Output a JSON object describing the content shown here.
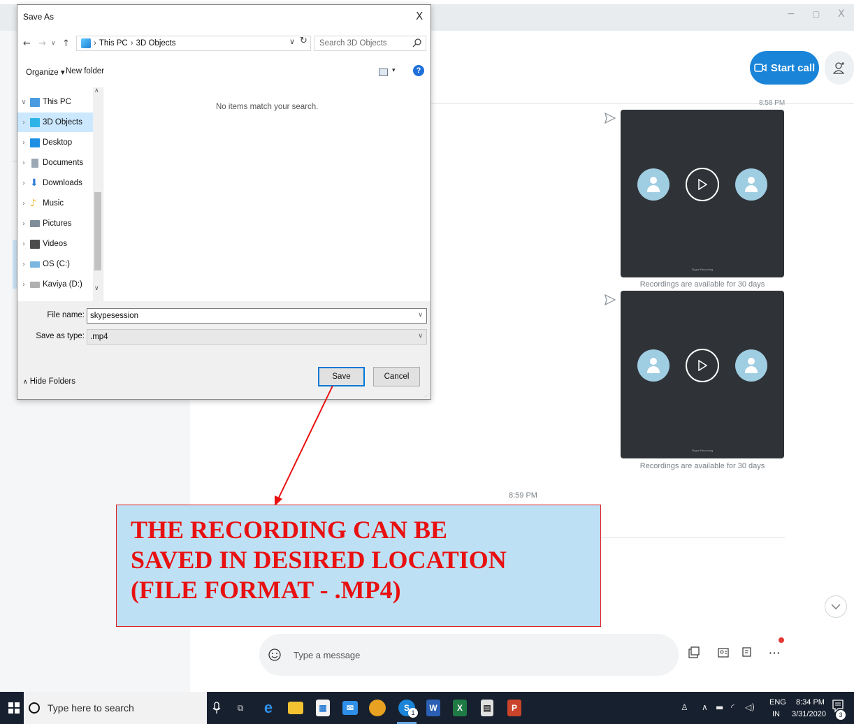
{
  "skype": {
    "start_call_label": "Start call",
    "cut_time": "8:58 PM",
    "recordings": [
      {
        "caption": "Recordings are available for 30 days",
        "watermark": "Skype Recording"
      },
      {
        "caption": "Recordings are available for 30 days",
        "watermark": "Skype Recording"
      }
    ],
    "message_time": "8:59 PM",
    "composer_placeholder": "Type a message",
    "window_controls": {
      "minimize": "−",
      "restore": "▢",
      "close": "X"
    }
  },
  "dialog": {
    "title": "Save As",
    "close": "X",
    "breadcrumb": [
      "This PC",
      "3D Objects"
    ],
    "search_placeholder": "Search 3D Objects",
    "toolbar": {
      "organize": "Organize ▾",
      "new_folder": "New folder"
    },
    "nav_items": [
      {
        "label": "This PC",
        "icon": "computer-icon",
        "color": "#4a9be0"
      },
      {
        "label": "3D Objects",
        "icon": "3d-objects-icon",
        "color": "#2fb4e8"
      },
      {
        "label": "Desktop",
        "icon": "desktop-icon",
        "color": "#1f8fe3"
      },
      {
        "label": "Documents",
        "icon": "documents-icon",
        "color": "#9aa8b5"
      },
      {
        "label": "Downloads",
        "icon": "downloads-icon",
        "color": "#2f7fd6"
      },
      {
        "label": "Music",
        "icon": "music-icon",
        "color": "#f2b526"
      },
      {
        "label": "Pictures",
        "icon": "pictures-icon",
        "color": "#7f8c99"
      },
      {
        "label": "Videos",
        "icon": "videos-icon",
        "color": "#4b4b4b"
      },
      {
        "label": "OS (C:)",
        "icon": "drive-c-icon",
        "color": "#7ab6e0"
      },
      {
        "label": "Kaviya (D:)",
        "icon": "drive-d-icon",
        "color": "#b0b0b0"
      }
    ],
    "empty_message": "No items match your search.",
    "file_name_label": "File name:",
    "file_name_value": "skypesession",
    "save_as_type_label": "Save as type:",
    "save_as_type_value": ".mp4",
    "hide_folders": "Hide Folders",
    "save_button": "Save",
    "cancel_button": "Cancel"
  },
  "annotation": {
    "lines": [
      "THE RECORDING CAN BE",
      "SAVED IN DESIRED LOCATION",
      "(FILE FORMAT - .MP4)"
    ],
    "color": "#e81010"
  },
  "taskbar": {
    "search_placeholder": "Type here to search",
    "skype_badge": "1",
    "language_top": "ENG",
    "language_bottom": "IN",
    "time": "8:34 PM",
    "date": "3/31/2020",
    "notification_count": "3"
  }
}
